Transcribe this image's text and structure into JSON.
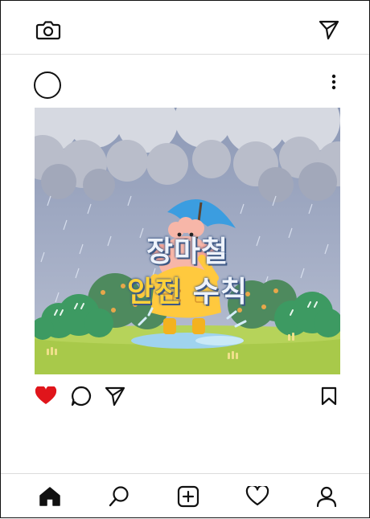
{
  "top_bar": {
    "camera_icon": "camera-icon",
    "direct_icon": "send-icon"
  },
  "post": {
    "more_icon": "more-vertical-icon",
    "image": {
      "title_line1": "장마철",
      "title_line2_highlight": "안전",
      "title_line2_rest": "수칙"
    },
    "liked": true,
    "like_color": "#e0151b"
  },
  "bottom_nav": {
    "items": [
      "home-icon",
      "search-icon",
      "add-post-icon",
      "activity-heart-icon",
      "profile-icon"
    ]
  }
}
